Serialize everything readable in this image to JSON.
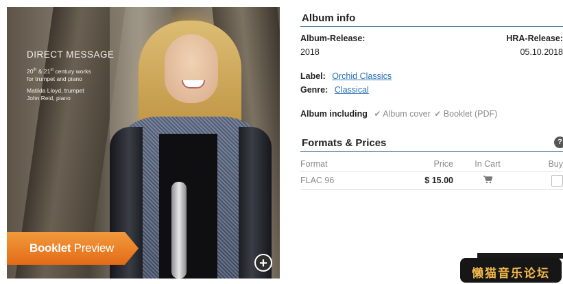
{
  "cover": {
    "title": "DIRECT MESSAGE",
    "subtitle_line1": "20th & 21st century works",
    "subtitle_line2": "for trumpet and piano",
    "performer1": "Matilda Lloyd, trumpet",
    "performer2": "John Reid, piano",
    "booklet_bold": "Booklet",
    "booklet_rest": " Preview",
    "zoom_icon": "+"
  },
  "album_info": {
    "title": "Album info",
    "album_release_label": "Album-Release:",
    "album_release_value": "2018",
    "hra_release_label": "HRA-Release:",
    "hra_release_value": "05.10.2018",
    "label_label": "Label:",
    "label_value": "Orchid Classics",
    "genre_label": "Genre:",
    "genre_value": "Classical",
    "including_label": "Album including",
    "including_items": [
      "Album cover",
      "Booklet (PDF)"
    ]
  },
  "formats": {
    "title": "Formats & Prices",
    "help_icon": "?",
    "headers": {
      "format": "Format",
      "price": "Price",
      "cart": "In Cart",
      "buy": "Buy"
    },
    "rows": [
      {
        "format": "FLAC 96",
        "price": "$ 15.00"
      }
    ]
  },
  "watermark": {
    "text": "懒猫音乐论坛"
  },
  "colors": {
    "accent_line": "#3d6f94",
    "link": "#2a6fb2",
    "banner_orange": "#e36b17"
  }
}
